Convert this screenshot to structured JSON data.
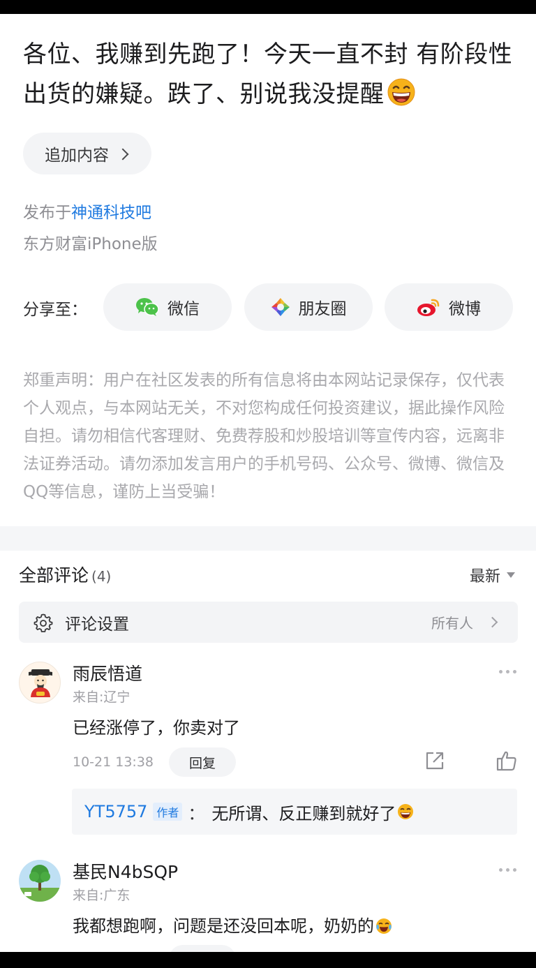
{
  "post": {
    "title": "各位、我赚到先跑了！今天一直不封 有阶段性出货的嫌疑。跌了、别说我没提醒",
    "title_emoji": "grinning-face-emoji",
    "append_label": "追加内容",
    "publish_prefix": "发布于",
    "forum_name": "神通科技吧",
    "client": "东方财富iPhone版"
  },
  "share": {
    "label": "分享至：",
    "targets": [
      {
        "label": "微信",
        "icon": "wechat-icon"
      },
      {
        "label": "朋友圈",
        "icon": "moments-icon"
      },
      {
        "label": "微博",
        "icon": "weibo-icon"
      }
    ]
  },
  "disclaimer": "郑重声明：用户在社区发表的所有信息将由本网站记录保存，仅代表个人观点，与本网站无关，不对您构成任何投资建议，据此操作风险自担。请勿相信代客理财、免费荐股和炒股培训等宣传内容，远离非法证券活动。请勿添加发言用户的手机号码、公众号、微博、微信及QQ等信息，谨防上当受骗！",
  "comments_header": {
    "title": "全部评论",
    "count": "(4)",
    "sort_label": "最新"
  },
  "comment_settings": {
    "label": "评论设置",
    "value": "所有人"
  },
  "comments": [
    {
      "name": "雨辰悟道",
      "location": "来自:辽宁",
      "text": "已经涨停了，你卖对了",
      "time": "10-21 13:38",
      "reply_label": "回复",
      "reply": {
        "name": "YT5757",
        "tag": "作者",
        "colon": "：",
        "text": "无所谓、反正赚到就好了"
      }
    },
    {
      "name": "基民N4bSQP",
      "location": "来自:广东",
      "text": "我都想跑啊，问题是还没回本呢，奶奶的"
    }
  ],
  "colors": {
    "link_blue": "#1f7ae0",
    "muted": "#a9a9ad",
    "pill_bg": "#f3f4f6"
  }
}
